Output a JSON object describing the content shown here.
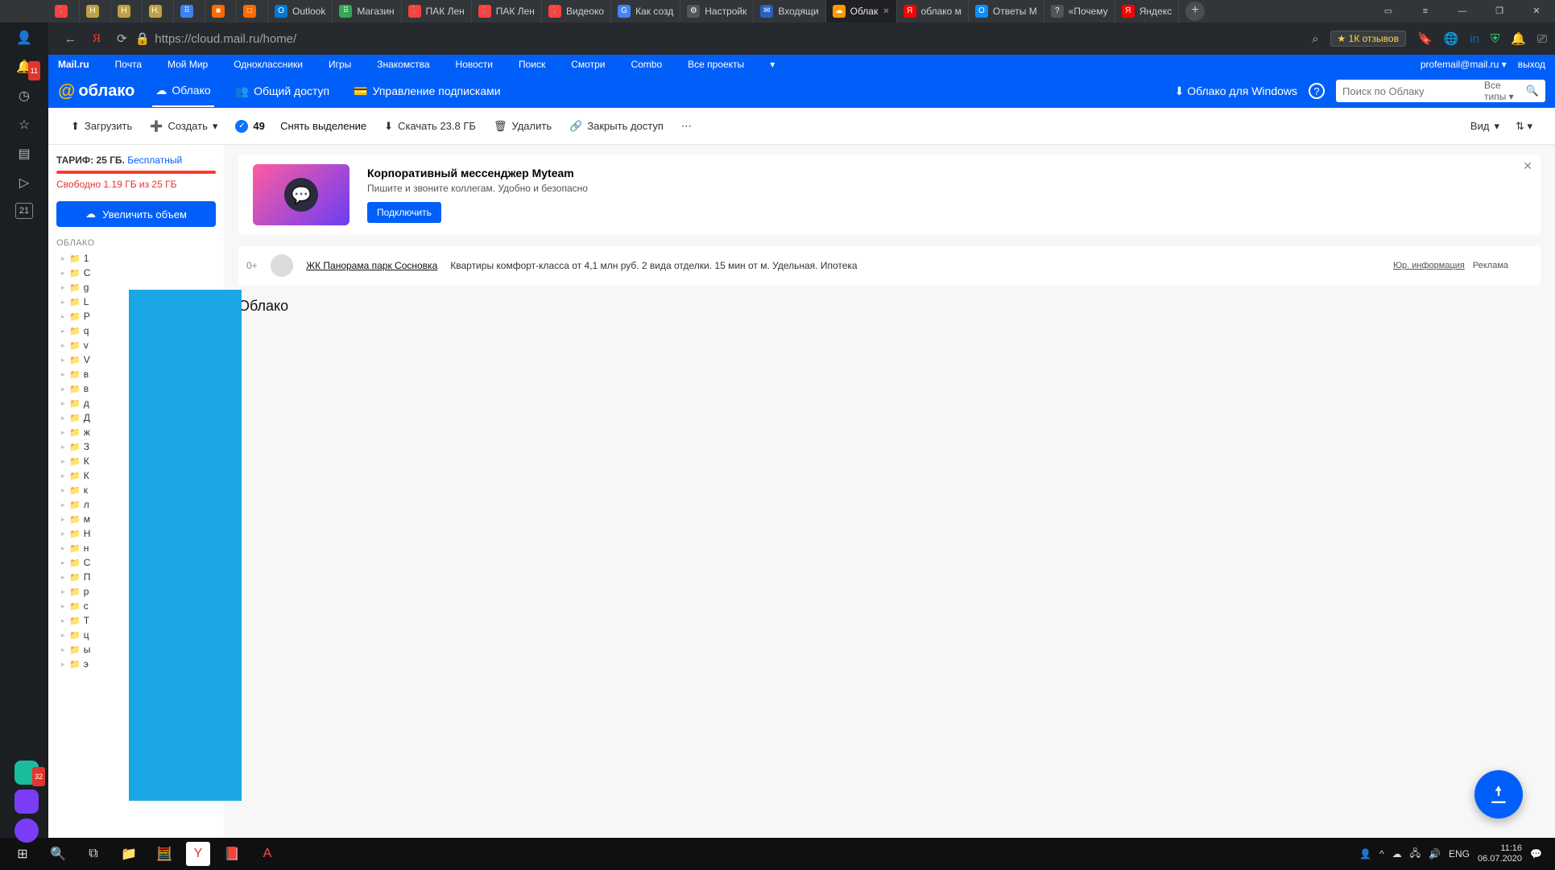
{
  "browser": {
    "tabs": [
      {
        "icon": "📍",
        "label": "",
        "color": "#ff4040"
      },
      {
        "icon": "H",
        "label": "",
        "color": "#c0a040"
      },
      {
        "icon": "H",
        "label": "",
        "color": "#c0a040"
      },
      {
        "icon": "H.",
        "label": "",
        "color": "#c0a040"
      },
      {
        "icon": "⠿",
        "label": "",
        "color": "#3b82f6"
      },
      {
        "icon": "■",
        "label": "",
        "color": "#ff6a00"
      },
      {
        "icon": "□",
        "label": "",
        "color": "#ff6a00"
      },
      {
        "icon": "O",
        "label": "Outlook",
        "color": "#0078d4"
      },
      {
        "icon": "⠿",
        "label": "Магазин",
        "color": "#34a853"
      },
      {
        "icon": "📍",
        "label": "ПАК Лен",
        "color": "#ff4040"
      },
      {
        "icon": "📍",
        "label": "ПАК Лен",
        "color": "#ff4040"
      },
      {
        "icon": "📍",
        "label": "Видеоко",
        "color": "#ff4040"
      },
      {
        "icon": "G",
        "label": "Как созд",
        "color": "#4285f4"
      },
      {
        "icon": "⚙",
        "label": "Настройк",
        "color": "#555"
      },
      {
        "icon": "✉",
        "label": "Входящи",
        "color": "#2b5fc4"
      },
      {
        "icon": "☁",
        "label": "Облак",
        "color": "#ff9800",
        "active": true
      },
      {
        "icon": "Я",
        "label": "облако м",
        "color": "#ff0000"
      },
      {
        "icon": "О",
        "label": "Ответы M",
        "color": "#0f8cff"
      },
      {
        "icon": "?",
        "label": "«Почему",
        "color": "#555"
      },
      {
        "icon": "Я",
        "label": "Яндекс",
        "color": "#ff0000"
      }
    ],
    "url": "https://cloud.mail.ru/home/",
    "reviews": "★ 1К отзывов",
    "notif_count": "11"
  },
  "yandex_sidebar": {
    "calendar_day": "21",
    "bottom_badge": "32"
  },
  "mailstrip": {
    "items": [
      "Mail.ru",
      "Почта",
      "Мой Мир",
      "Одноклассники",
      "Игры",
      "Знакомства",
      "Новости",
      "Поиск",
      "Смотри",
      "Combo",
      "Все проекты"
    ],
    "email": "profemail@mail.ru",
    "exit": "выход"
  },
  "cloud_nav": {
    "brand": "облако",
    "items": [
      {
        "icon": "☁",
        "label": "Облако",
        "active": true
      },
      {
        "icon": "👥",
        "label": "Общий доступ"
      },
      {
        "icon": "💳",
        "label": "Управление подписками"
      }
    ],
    "windows": "Облако для Windows",
    "search_placeholder": "Поиск по Облаку",
    "search_types": "Все типы"
  },
  "toolbar": {
    "upload": "Загрузить",
    "create": "Создать",
    "sel_count": "49",
    "unselect": "Снять выделение",
    "download": "Скачать 23.8 ГБ",
    "delete": "Удалить",
    "close_access": "Закрыть доступ",
    "view": "Вид"
  },
  "sidebar": {
    "tariff_label": "ТАРИФ: 25 ГБ.",
    "tariff_free": "Бесплатный",
    "freespace": "Свободно 1.19 ГБ из 25 ГБ",
    "increase": "Увеличить объем",
    "section": "ОБЛАКО",
    "folders": [
      "1",
      "С",
      "g",
      "L",
      "P",
      "q",
      "v",
      "V",
      "в",
      "в",
      "д",
      "Д",
      "ж",
      "З",
      "К",
      "К",
      "к",
      "л",
      "м",
      "Н",
      "н",
      "С",
      "П",
      "р",
      "с",
      "Т",
      "ц",
      "ы",
      "э"
    ]
  },
  "promo": {
    "title": "Корпоративный мессенджер Myteam",
    "desc": "Пишите и звоните коллегам. Удобно и безопасно",
    "btn": "Подключить"
  },
  "ad": {
    "age": "0+",
    "title": "ЖК Панорама парк Сосновка",
    "text": "Квартиры комфорт-класса от 4,1 млн руб. 2 вида отделки. 15 мин от м. Удельная. Ипотека",
    "legal": "Юр. информация",
    "label": "Реклама"
  },
  "main": {
    "title": "Облако"
  },
  "taskbar": {
    "lang": "ENG",
    "time": "11:16",
    "date": "06.07.2020"
  }
}
